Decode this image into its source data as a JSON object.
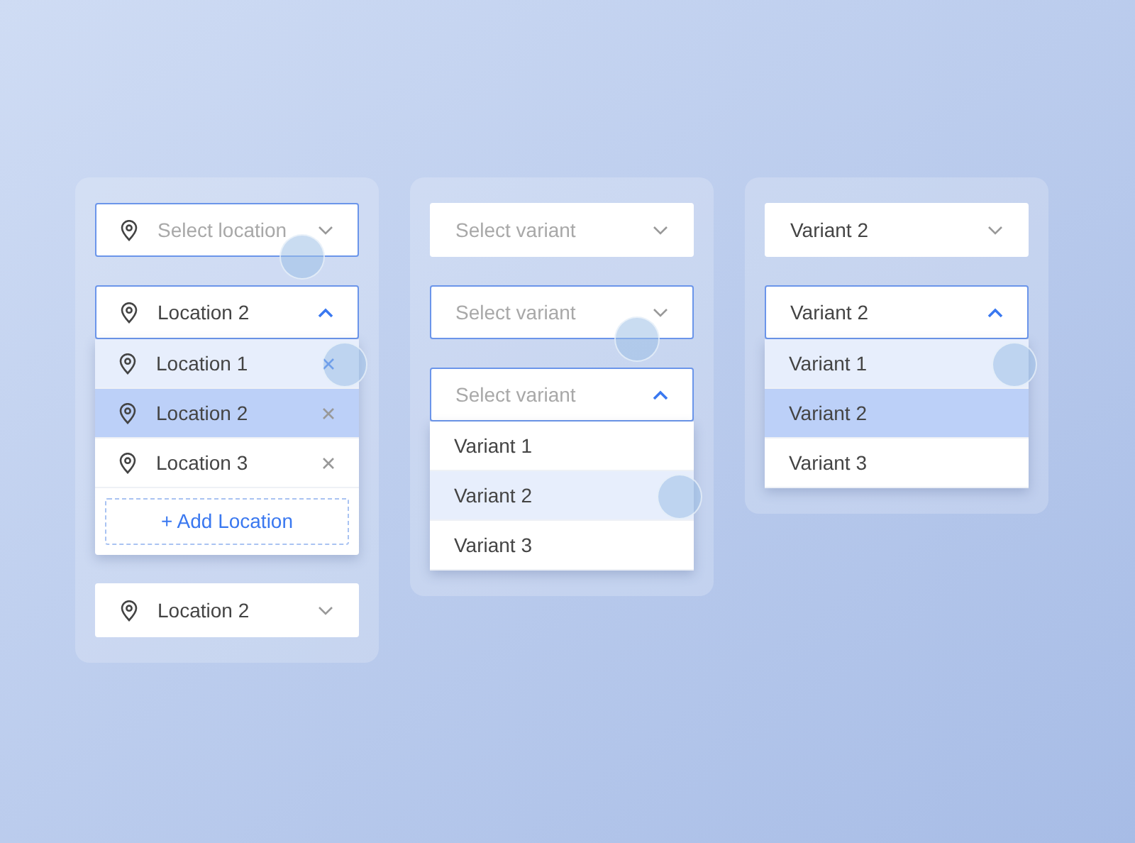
{
  "cards": [
    {
      "selects": [
        {
          "icon": true,
          "text": "Select location",
          "placeholder": true,
          "focused": true,
          "expanded": false,
          "touch": true
        },
        {
          "icon": true,
          "text": "Location 2",
          "placeholder": false,
          "focused": true,
          "expanded": true,
          "touch": false,
          "options": [
            {
              "text": "Location 1",
              "hovered": true,
              "selected": false,
              "removable": true,
              "touch": true
            },
            {
              "text": "Location 2",
              "hovered": false,
              "selected": true,
              "removable": true,
              "touch": false
            },
            {
              "text": "Location 3",
              "hovered": false,
              "selected": false,
              "removable": true,
              "touch": false
            }
          ],
          "add_button": "+ Add Location"
        },
        {
          "icon": true,
          "text": "Location 2",
          "placeholder": false,
          "focused": false,
          "expanded": false,
          "touch": false
        }
      ]
    },
    {
      "selects": [
        {
          "icon": false,
          "text": "Select variant",
          "placeholder": true,
          "focused": false,
          "expanded": false,
          "touch": false
        },
        {
          "icon": false,
          "text": "Select variant",
          "placeholder": true,
          "focused": true,
          "expanded": false,
          "touch": true
        },
        {
          "icon": false,
          "text": "Select variant",
          "placeholder": true,
          "focused": true,
          "expanded": true,
          "touch": false,
          "options": [
            {
              "text": "Variant 1",
              "hovered": false,
              "selected": false,
              "removable": false,
              "touch": false
            },
            {
              "text": "Variant 2",
              "hovered": true,
              "selected": false,
              "removable": false,
              "touch": true
            },
            {
              "text": "Variant 3",
              "hovered": false,
              "selected": false,
              "removable": false,
              "touch": false
            }
          ]
        }
      ]
    },
    {
      "selects": [
        {
          "icon": false,
          "text": "Variant 2",
          "placeholder": false,
          "focused": false,
          "expanded": false,
          "touch": false
        },
        {
          "icon": false,
          "text": "Variant 2",
          "placeholder": false,
          "focused": true,
          "expanded": true,
          "touch": false,
          "options": [
            {
              "text": "Variant 1",
              "hovered": true,
              "selected": false,
              "removable": false,
              "touch": true
            },
            {
              "text": "Variant 2",
              "hovered": false,
              "selected": true,
              "removable": false,
              "touch": false
            },
            {
              "text": "Variant 3",
              "hovered": false,
              "selected": false,
              "removable": false,
              "touch": false
            }
          ]
        }
      ]
    }
  ]
}
